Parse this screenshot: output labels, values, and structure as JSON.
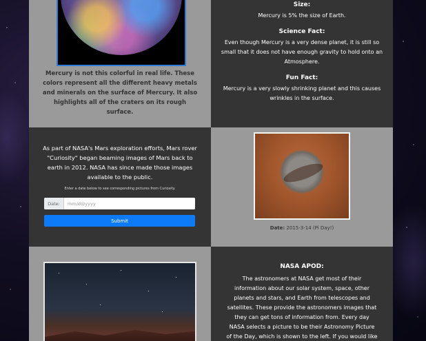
{
  "mercury": {
    "caption": "Mercury is not this colorful in real life. These colors represent all the different heavy metals and minerals on the surface of Mercury. It also highlights all of the craters on its rough surface.",
    "size_title": "Size:",
    "size_text": "Mercury is 5% the size of Earth.",
    "science_title": "Science Fact:",
    "science_text": "Even though Mercury is a very dense planet, it is still so small that it does not have enough gravity to hold onto an Atmosphere.",
    "fun_title": "Fun Fact:",
    "fun_text": "Mercury is a very slowly shrinking planet and this causes wrinkles in the surface."
  },
  "mars": {
    "intro": "As part of NASA's Mars exploration efforts, Mars rover \"Curiosity\" began beaming images of Mars back to earth in 2012. NASA has since made those images available to the public.",
    "hint": "Enter a date below to see corresponding pictures from Curiosity.",
    "date_label": "Date:",
    "date_placeholder": "mm/dd/yyyy",
    "submit_label": "Submit",
    "photo_date_label": "Date:",
    "photo_date_value": " 2015-3-14 (Pi Day!)"
  },
  "apod": {
    "title": "NASA APOD:",
    "text": "The astronomers at NASA get most of their information about our solar system, space, other planets and stars, and Earth from telescopes and satellites. These provide the astronomers images that they can get tons of information from. Every day NASA selects a picture to be their Astronomy Picture of the Day, which is shown to the left. If you would like to see more of these on our"
  },
  "colors": {
    "panel_light": "#9a9a9a",
    "panel_dark": "#343434",
    "accent_blue": "#0d7bf7"
  },
  "icons": [
    "mercury-image",
    "mars-rover-image",
    "apod-image"
  ]
}
